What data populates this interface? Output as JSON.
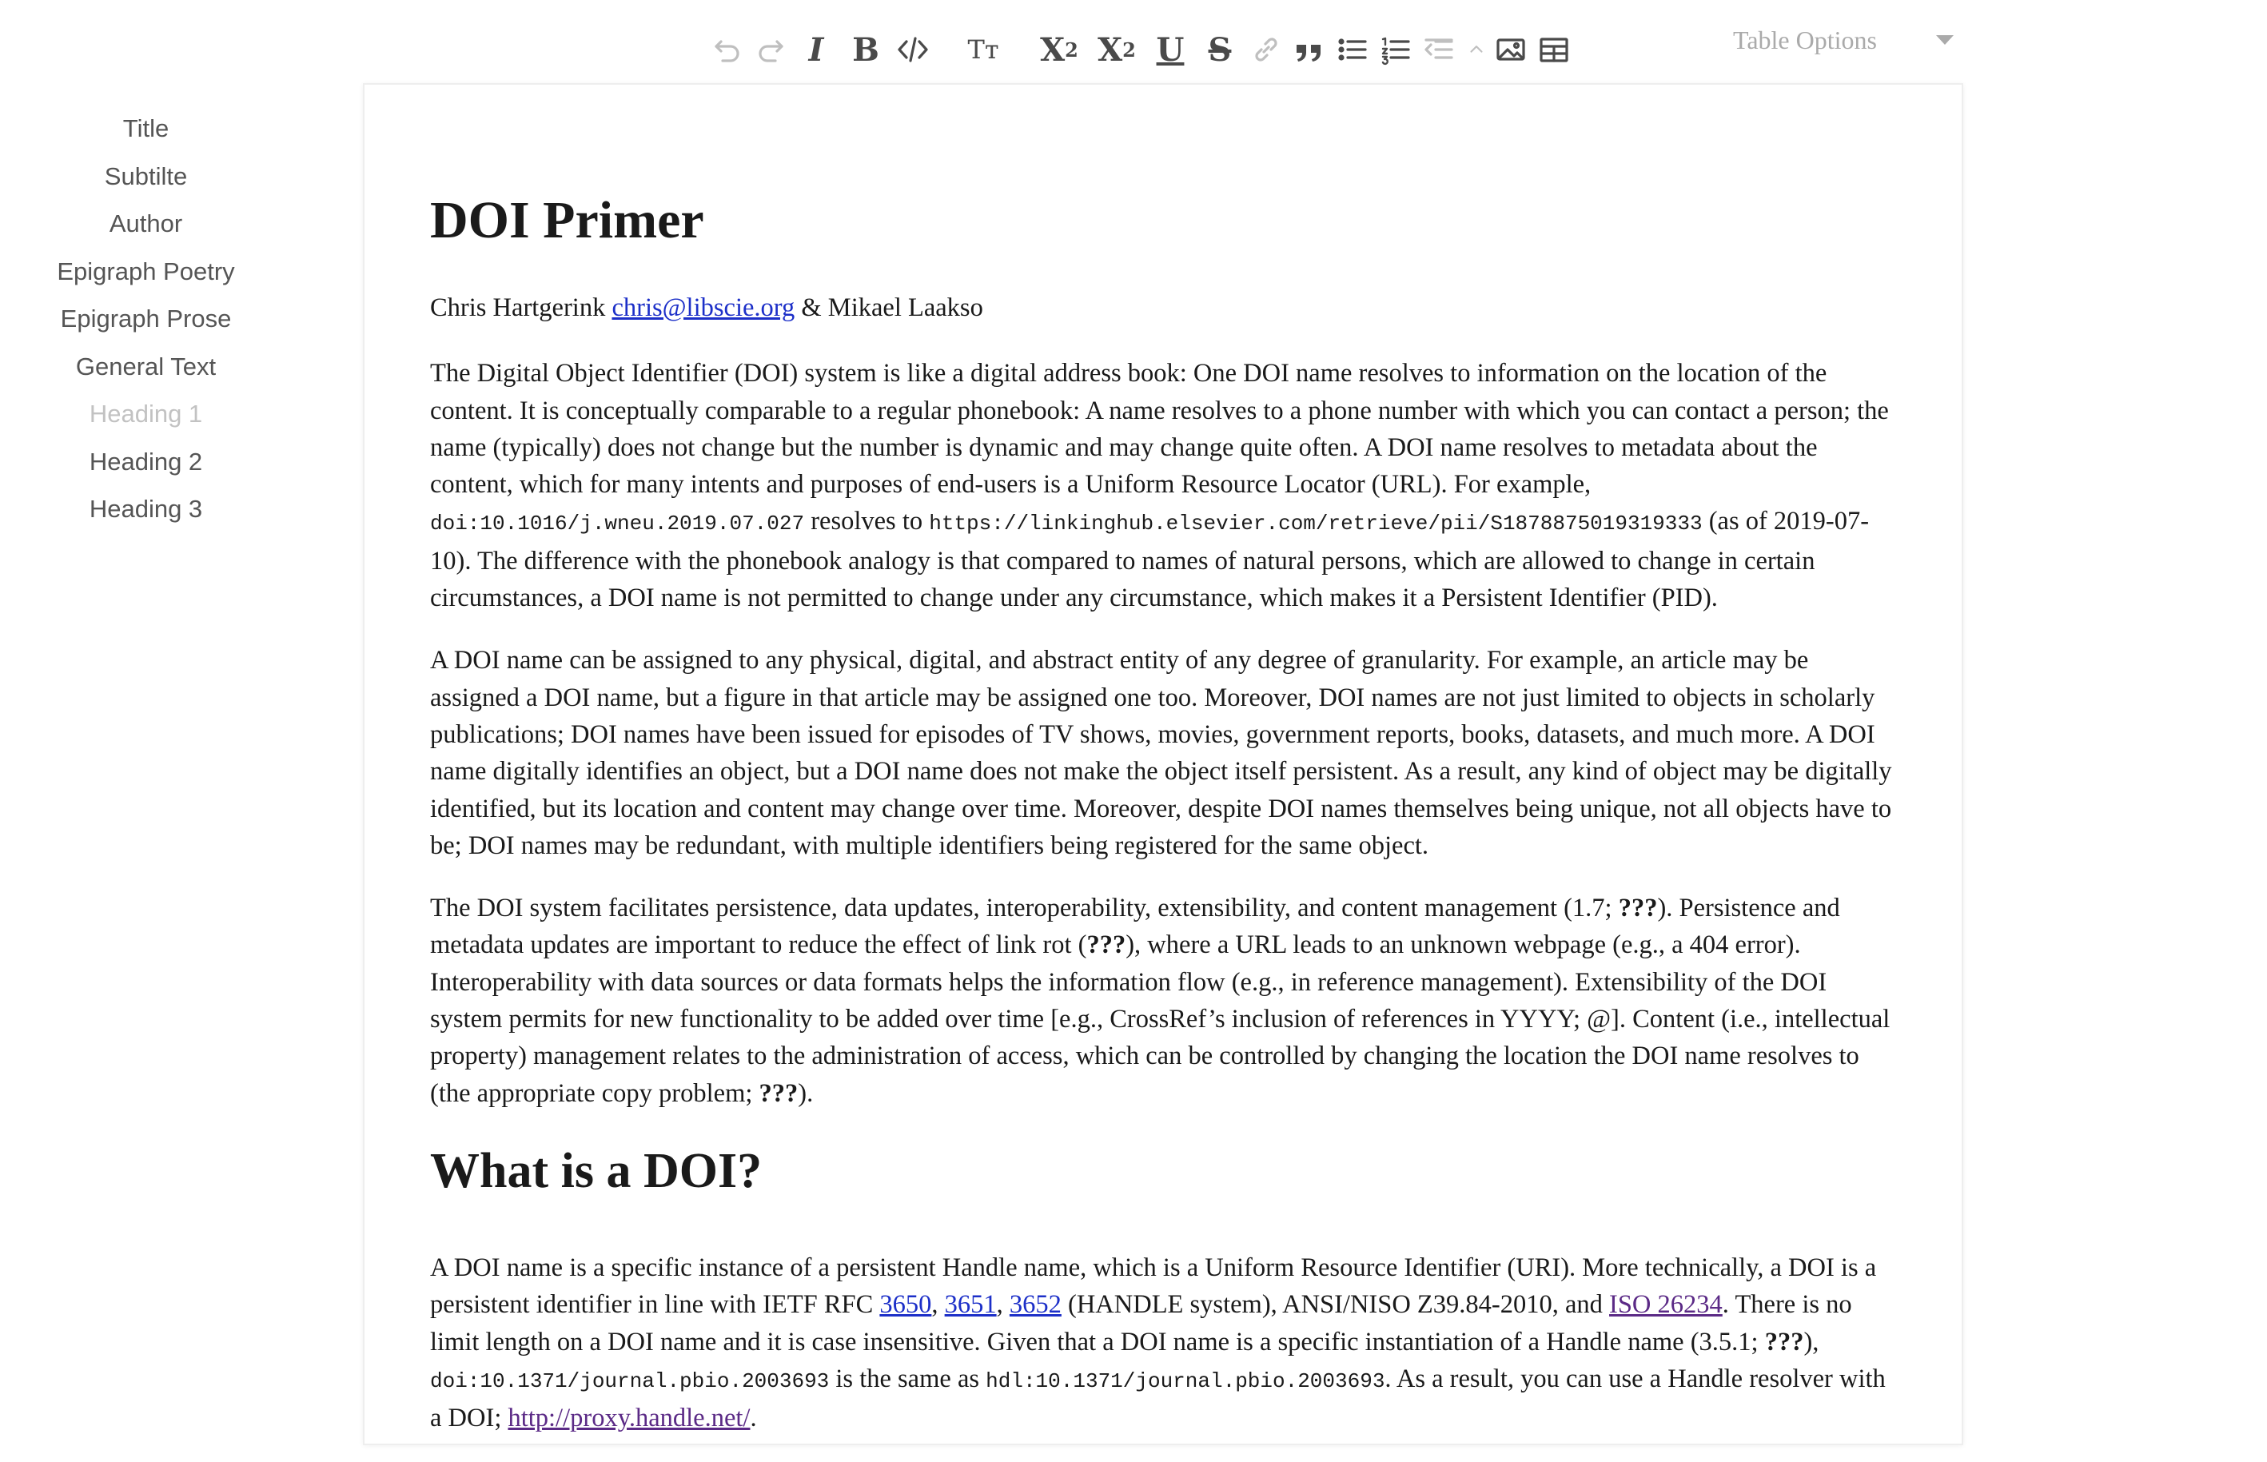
{
  "toolbar": {
    "items": [
      "undo-icon",
      "redo-icon",
      "italic",
      "bold",
      "code",
      "text-size",
      "subscript",
      "superscript",
      "underline",
      "strikethrough",
      "link-icon",
      "blockquote-icon",
      "bullet-list-icon",
      "ordered-list-icon",
      "outdent-icon",
      "lift-icon",
      "image-icon",
      "table-icon"
    ],
    "italic_label": "I",
    "bold_label": "B",
    "text_size_label": "Tт",
    "subscript_label": "X",
    "subscript_mark": "2",
    "superscript_label": "X",
    "superscript_mark": "2",
    "underline_label": "U",
    "strike_label": "S",
    "table_options": "Table Options"
  },
  "sidebar": {
    "items": [
      {
        "label": "Title"
      },
      {
        "label": "Subtilte"
      },
      {
        "label": "Author"
      },
      {
        "label": "Epigraph Poetry"
      },
      {
        "label": "Epigraph Prose"
      },
      {
        "label": "General Text"
      },
      {
        "label": "Heading 1"
      },
      {
        "label": "Heading 2"
      },
      {
        "label": "Heading 3"
      }
    ]
  },
  "doc": {
    "title": "DOI Primer",
    "author": {
      "name1": "Chris Hartgerink ",
      "email": "chris@libscie.org",
      "sep": " & Mikael Laakso"
    },
    "p1": {
      "t1": "The Digital Object Identifier (DOI) system is like a digital address book: One DOI name resolves to information on the location of the content. It is conceptually comparable to a regular phonebook: A name resolves to a phone number with which you can contact a person; the name (typically) does not change but the number is dynamic and may change quite often. A DOI name resolves to metadata about the content, which for many intents and purposes of end-users is a Uniform Resource Locator (URL). For example, ",
      "code1": "doi:10.1016/j.wneu.2019.07.027",
      "t2": " resolves to ",
      "code2": "https://linkinghub.elsevier.com/retrieve/pii/S1878875019319333",
      "t3": " (as of 2019-07-10). The difference with the phonebook analogy is that compared to names of natural persons, which are allowed to change in certain circumstances, a DOI name is not permitted to change under any circumstance, which makes it a Persistent Identifier (PID)."
    },
    "p2": "A DOI name can be assigned to any physical, digital, and abstract entity of any degree of granularity. For example, an article may be assigned a DOI name, but a figure in that article may be assigned one too. Moreover, DOI names are not just limited to objects in scholarly publications; DOI names have been issued for episodes of TV shows, movies, government reports, books, datasets, and much more. A DOI name digitally identifies an object, but a DOI name does not make the object itself persistent. As a result, any kind of object may be digitally identified, but its location and content may change over time. Moreover, despite DOI names themselves being unique, not all objects have to be; DOI names may be redundant, with multiple identifiers being registered for the same object.",
    "p3": {
      "t1": "The DOI system facilitates persistence, data updates, interoperability, extensibility, and content management (1.7; ",
      "q1": "???",
      "t2": "). Persistence and metadata updates are important to reduce the effect of link rot (",
      "q2": "???",
      "t3": "), where a URL leads to an unknown webpage (e.g., a 404 error). Interoperability with data sources or data formats helps the information flow (e.g., in reference management). Extensibility of the DOI system permits for new functionality to be added over time [e.g., CrossRef’s inclusion of references in YYYY; @]. Content (i.e., intellectual property) management relates to the administration of access, which can be controlled by changing the location the DOI name resolves to (the appropriate copy problem; ",
      "q3": "???",
      "t4": ")."
    },
    "h2": "What is a DOI?",
    "p4": {
      "t1": "A DOI name is a specific instance of a persistent Handle name, which is a Uniform Resource Identifier (URI). More technically, a DOI is a persistent identifier in line with IETF RFC ",
      "rfc1": "3650",
      "c1": ", ",
      "rfc2": "3651",
      "c2": ", ",
      "rfc3": "3652",
      "t2": " (HANDLE system), ANSI/NISO Z39.84-2010, and ",
      "iso": "ISO 26234",
      "t3": ". There is no limit length on a DOI name and it is case insensitive. Given that a DOI name is a specific instantiation of a Handle name (3.5.1; ",
      "q1": "???",
      "t4": "), ",
      "code1": "doi:10.1371/journal.pbio.2003693",
      "t5": " is the same as ",
      "code2": "hdl:10.1371/journal.pbio.2003693",
      "t6": ". As a result, you can use a Handle resolver with a DOI; ",
      "link": "http://proxy.handle.net/",
      "t7": "."
    }
  }
}
